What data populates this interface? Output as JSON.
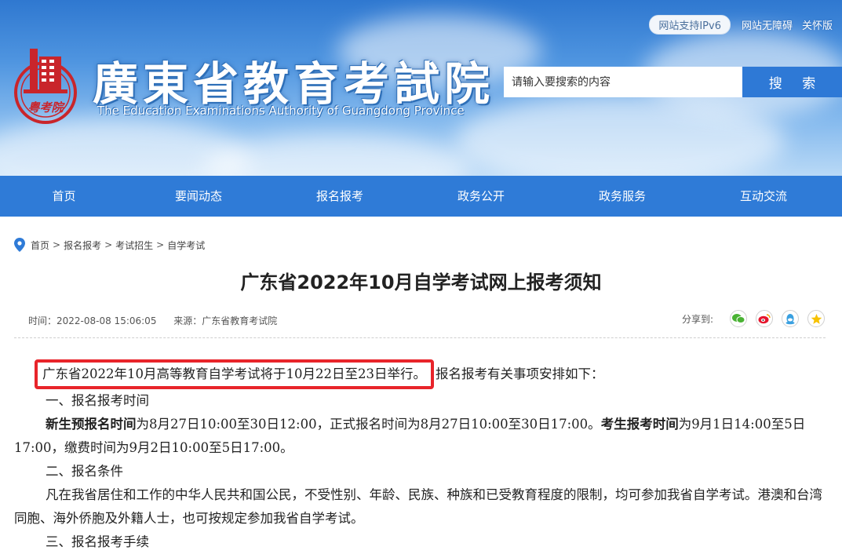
{
  "header": {
    "top_links": [
      "网站支持IPv6",
      "网站无障碍",
      "关怀版"
    ],
    "title_cn": "廣東省教育考試院",
    "title_en": "The Education Examinations Authority of Guangdong Province",
    "logo_text": "粤考院",
    "search_placeholder": "请输入要搜索的内容",
    "search_button": "搜 索"
  },
  "nav": [
    "首页",
    "要闻动态",
    "报名报考",
    "政务公开",
    "政务服务",
    "互动交流"
  ],
  "breadcrumb": [
    "首页",
    "报名报考",
    "考试招生",
    "自学考试"
  ],
  "article": {
    "title": "广东省2022年10月自学考试网上报考须知",
    "time": "时间：2022-08-08 15:06:05",
    "source": "来源：广东省教育考试院",
    "share_label": "分享到:",
    "share_icons": [
      "wechat-icon",
      "weibo-icon",
      "qq-icon",
      "qzone-icon"
    ],
    "intro_highlight": "广东省2022年10月高等教育自学考试将于10月22日至23日举行。",
    "intro_rest": "报名报考有关事项安排如下：",
    "section1_title": "一、报名报考时间",
    "s1_b1": "新生预报名时间",
    "s1_t1": "为8月27日10:00至30日12:00，正式报名时间为8月27日10:00至30日17:00。",
    "s1_b2": "考生报考时间",
    "s1_t2": "为9月1日14:00至5日17:00，缴费时间为9月2日10:00至5日17:00。",
    "section2_title": "二、报名条件",
    "s2_text": "凡在我省居住和工作的中华人民共和国公民，不受性别、年龄、民族、种族和已受教育程度的限制，均可参加我省自学考试。港澳和台湾同胞、海外侨胞及外籍人士，也可按规定参加我省自学考试。",
    "section3_title": "三、报名报考手续"
  },
  "colors": {
    "nav_blue": "#2f7bd7",
    "search_blue": "#2e79d6",
    "highlight_red": "#e8242a"
  }
}
